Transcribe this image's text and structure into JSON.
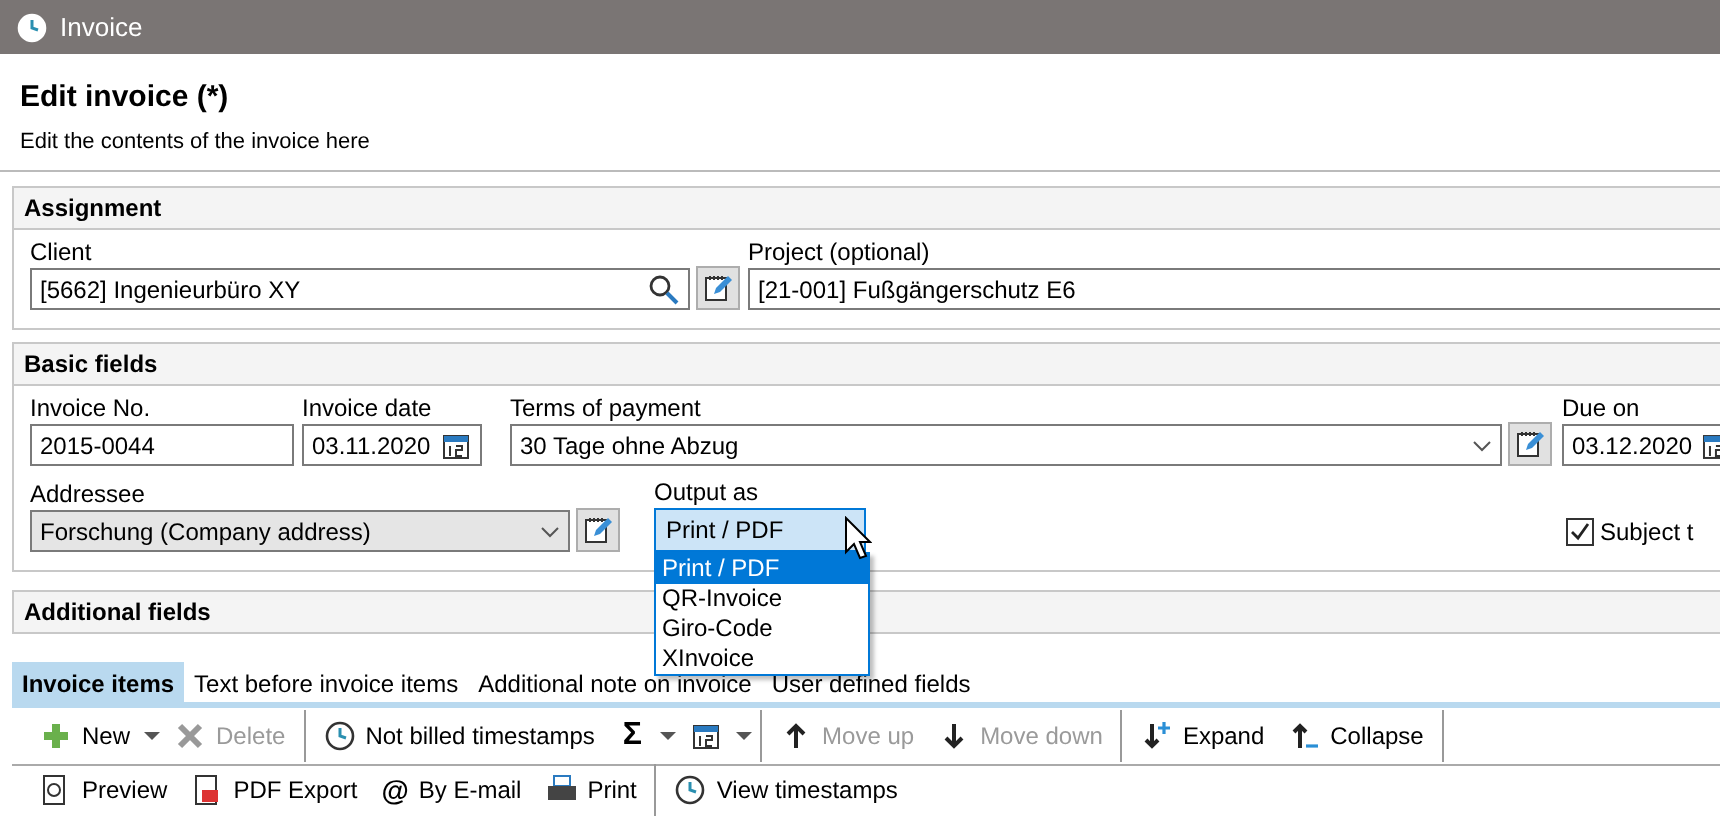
{
  "window": {
    "title": "Invoice"
  },
  "header": {
    "title": "Edit invoice (*)",
    "subtitle": "Edit the contents of the invoice here"
  },
  "assignment": {
    "title": "Assignment",
    "client": {
      "label": "Client",
      "value": "[5662] Ingenieurbüro XY"
    },
    "project": {
      "label": "Project (optional)",
      "value": "[21-001] Fußgängerschutz E6"
    }
  },
  "basic_fields": {
    "title": "Basic fields",
    "invoice_no": {
      "label": "Invoice No.",
      "value": "2015-0044"
    },
    "invoice_date": {
      "label": "Invoice date",
      "value": "03.11.2020"
    },
    "terms_of_payment": {
      "label": "Terms of payment",
      "value": "30 Tage ohne Abzug"
    },
    "due_on": {
      "label": "Due on",
      "value": "03.12.2020"
    },
    "addressee": {
      "label": "Addressee",
      "value": "Forschung (Company address)"
    },
    "output_as": {
      "label": "Output as",
      "value": "Print / PDF",
      "open": true,
      "options": [
        {
          "label": "Print / PDF",
          "selected": true
        },
        {
          "label": "QR-Invoice",
          "selected": false
        },
        {
          "label": "Giro-Code",
          "selected": false
        },
        {
          "label": "XInvoice",
          "selected": false
        }
      ]
    },
    "subject_checkbox": {
      "label": "Subject t",
      "checked": true
    }
  },
  "additional_fields": {
    "title": "Additional fields"
  },
  "tabs": [
    {
      "label": "Invoice items",
      "selected": true
    },
    {
      "label": "Text before invoice items",
      "selected": false
    },
    {
      "label": "Additional note on invoice",
      "selected": false
    },
    {
      "label": "User defined fields",
      "selected": false
    }
  ],
  "toolbar": [
    {
      "kind": "button",
      "label": "New",
      "disabled": false
    },
    {
      "kind": "caret"
    },
    {
      "kind": "button",
      "label": "Delete",
      "disabled": true
    },
    {
      "kind": "separator"
    },
    {
      "kind": "button",
      "label": "Not billed timestamps",
      "disabled": false
    },
    {
      "kind": "glyph",
      "glyph": "Σ"
    },
    {
      "kind": "caret"
    },
    {
      "kind": "icon"
    },
    {
      "kind": "caret"
    },
    {
      "kind": "separator"
    },
    {
      "kind": "button",
      "label": "Move up",
      "disabled": true
    },
    {
      "kind": "button",
      "label": "Move down",
      "disabled": true
    },
    {
      "kind": "separator"
    },
    {
      "kind": "button",
      "label": "Expand",
      "disabled": false
    },
    {
      "kind": "button",
      "label": "Collapse",
      "disabled": false
    },
    {
      "kind": "separator"
    }
  ],
  "toolbar_2": [
    {
      "kind": "button",
      "label": "Preview",
      "disabled": false
    },
    {
      "kind": "button",
      "label": "PDF Export",
      "disabled": false
    },
    {
      "kind": "button",
      "glyph": "@",
      "label": "By E-mail",
      "disabled": false
    },
    {
      "kind": "button",
      "label": "Print",
      "disabled": false
    },
    {
      "kind": "separator"
    },
    {
      "kind": "button",
      "label": "View timestamps",
      "disabled": false
    }
  ]
}
